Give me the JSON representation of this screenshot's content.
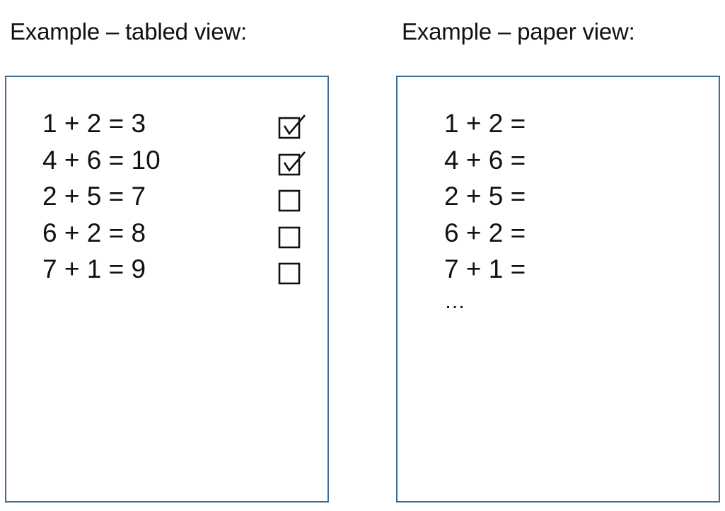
{
  "left": {
    "title": "Example – tabled view:",
    "rows": [
      {
        "equation": "1 + 2 = 3",
        "checked": true
      },
      {
        "equation": "4 + 6 = 10",
        "checked": true
      },
      {
        "equation": "2 + 5 = 7",
        "checked": false
      },
      {
        "equation": "6 + 2 = 8",
        "checked": false
      },
      {
        "equation": "7 + 1 = 9",
        "checked": false
      }
    ],
    "icons": {
      "checked": "checked-box-icon",
      "unchecked": "empty-box-icon"
    }
  },
  "right": {
    "title": "Example – paper view:",
    "rows": [
      "1 + 2 =",
      "4 + 6 =",
      "2 + 5 =",
      "6 + 2 =",
      "7 + 1 ="
    ],
    "ellipsis": "…"
  },
  "colors": {
    "panel_border": "#3f6b97",
    "text": "#111111"
  }
}
